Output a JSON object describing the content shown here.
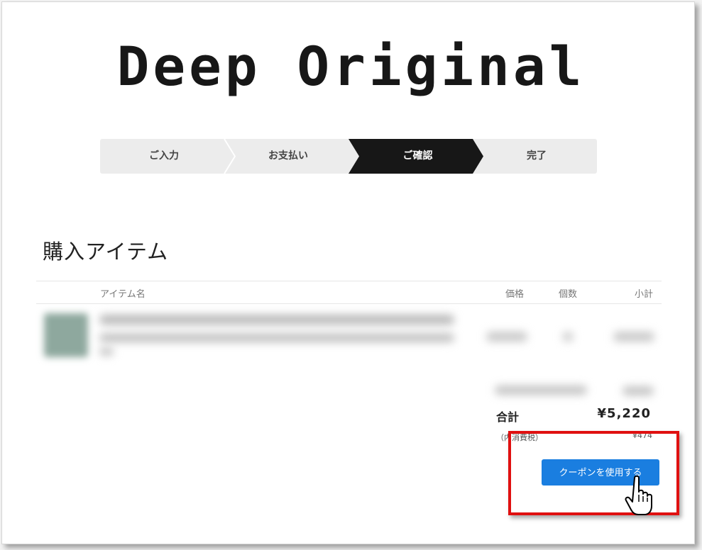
{
  "brand": {
    "logo_text": "Deep Original"
  },
  "steps": [
    {
      "label": "ご入力",
      "active": false
    },
    {
      "label": "お支払い",
      "active": false
    },
    {
      "label": "ご確認",
      "active": true
    },
    {
      "label": "完了",
      "active": false
    }
  ],
  "section": {
    "title": "購入アイテム"
  },
  "table": {
    "headers": {
      "item": "アイテム名",
      "price": "価格",
      "qty": "個数",
      "subtotal": "小計"
    }
  },
  "summary": {
    "total_label": "合計",
    "total_value": "¥5,220",
    "tax_label": "（内消費税）",
    "tax_value": "¥474"
  },
  "coupon": {
    "button_label": "クーポンを使用する"
  },
  "colors": {
    "accent": "#1a7ee0",
    "active_step": "#171717",
    "highlight": "#e01010"
  },
  "icons": {
    "cursor": "hand-pointer-icon"
  }
}
